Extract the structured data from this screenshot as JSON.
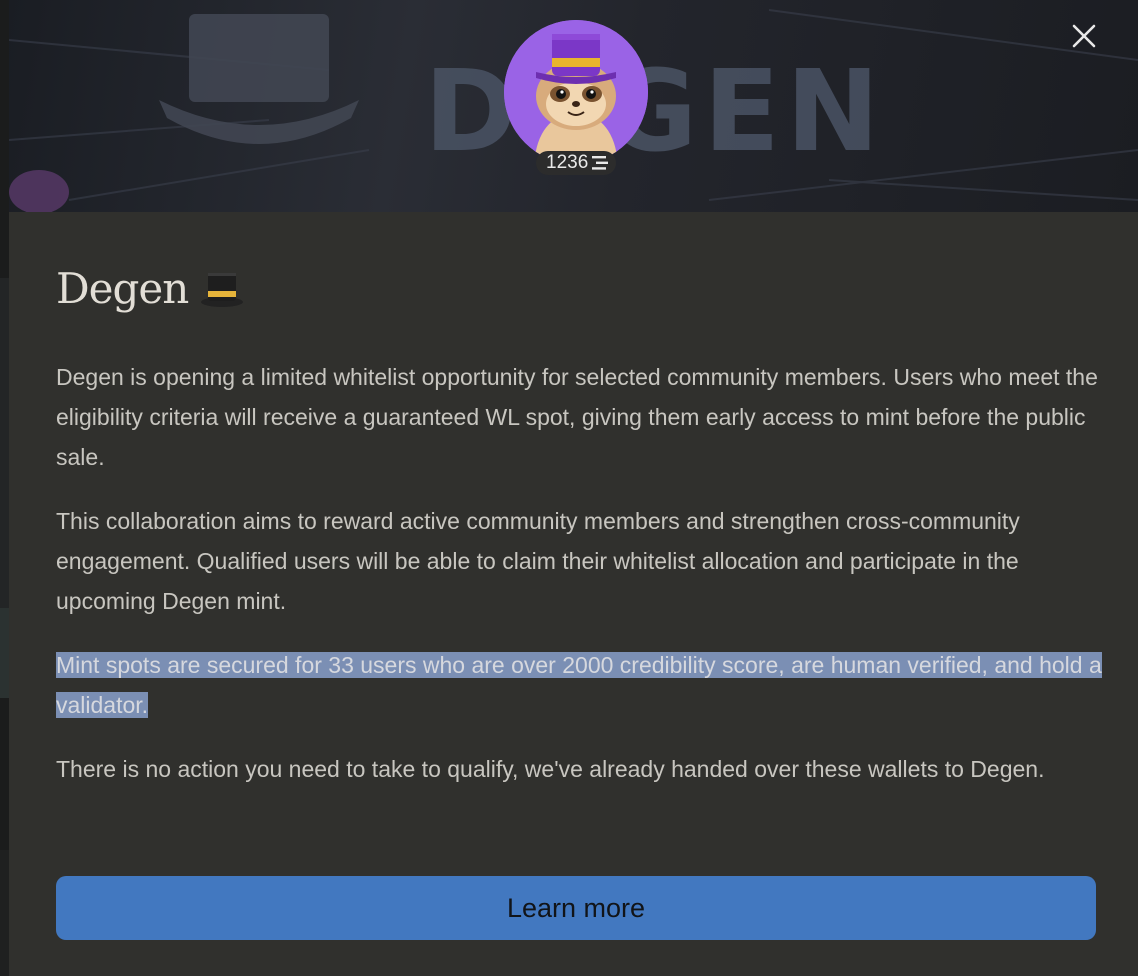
{
  "banner": {
    "brand_text": "DEGEN"
  },
  "profile": {
    "score": "1236",
    "score_icon": "stacked-lines-icon",
    "avatar": "sloth-with-top-hat-avatar"
  },
  "close_icon": "close-icon",
  "title": "Degen",
  "title_icon": "top-hat-emoji",
  "paragraphs": [
    "Degen is opening a limited whitelist opportunity for selected community members. Users who meet the eligibility criteria will receive a guaranteed WL spot, giving them early access to mint before the public sale.",
    "This collaboration aims to reward active community members and strengthen cross-community engagement. Qualified users will be able to claim their whitelist allocation and participate in the upcoming Degen mint.",
    "Mint spots are secured for 33 users who are over 2000 credibility score, are human verified, and hold a validator.",
    "There is no action you need to take to qualify, we've already handed over these wallets to Degen."
  ],
  "learn_more_label": "Learn more",
  "colors": {
    "modal_bg": "#30302d",
    "button": "#4278c0",
    "highlight": "#7b8fb4",
    "avatar_bg": "#9a63e6"
  }
}
